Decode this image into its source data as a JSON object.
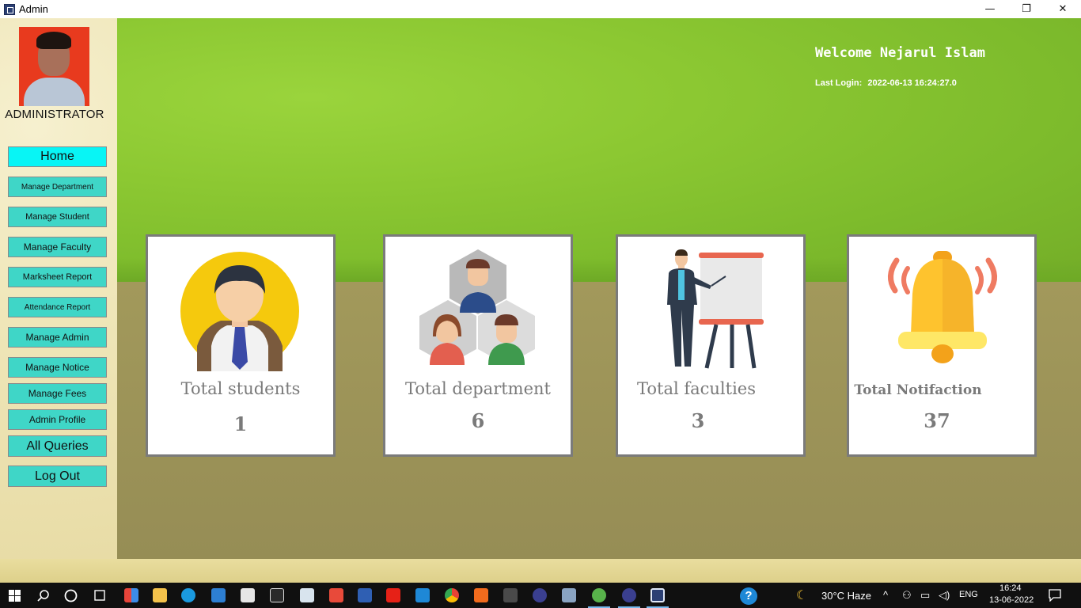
{
  "window": {
    "title": "Admin",
    "minimize": "—",
    "maximize": "❐",
    "close": "✕"
  },
  "sidebar": {
    "role_label": "ADMINISTRATOR",
    "items": [
      {
        "label": "Home"
      },
      {
        "label": "Manage Department"
      },
      {
        "label": "Manage Student"
      },
      {
        "label": "Manage Faculty"
      },
      {
        "label": "Marksheet Report"
      },
      {
        "label": "Attendance Report"
      },
      {
        "label": "Manage Admin"
      },
      {
        "label": "Manage Notice"
      },
      {
        "label": "Manage Fees"
      },
      {
        "label": "Admin Profile"
      },
      {
        "label": "All Queries"
      },
      {
        "label": "Log Out"
      }
    ]
  },
  "header": {
    "welcome": "Welcome Nejarul Islam",
    "last_login_label": "Last Login:",
    "last_login_value": "2022-06-13 16:24:27.0"
  },
  "cards": [
    {
      "title": "Total students",
      "count": "1",
      "icon": "student-icon"
    },
    {
      "title": "Total department",
      "count": "6",
      "icon": "department-icon"
    },
    {
      "title": "Total faculties",
      "count": "3",
      "icon": "teacher-icon"
    },
    {
      "title": "Total Notifaction",
      "count": "37",
      "icon": "bell-icon"
    }
  ],
  "taskbar": {
    "weather": "30°C  Haze",
    "language": "ENG",
    "time": "16:24",
    "date": "13-06-2022"
  },
  "colors": {
    "nav_button": "#3fd6c7",
    "nav_active": "#08f5f5",
    "taskbar": "#101010"
  }
}
